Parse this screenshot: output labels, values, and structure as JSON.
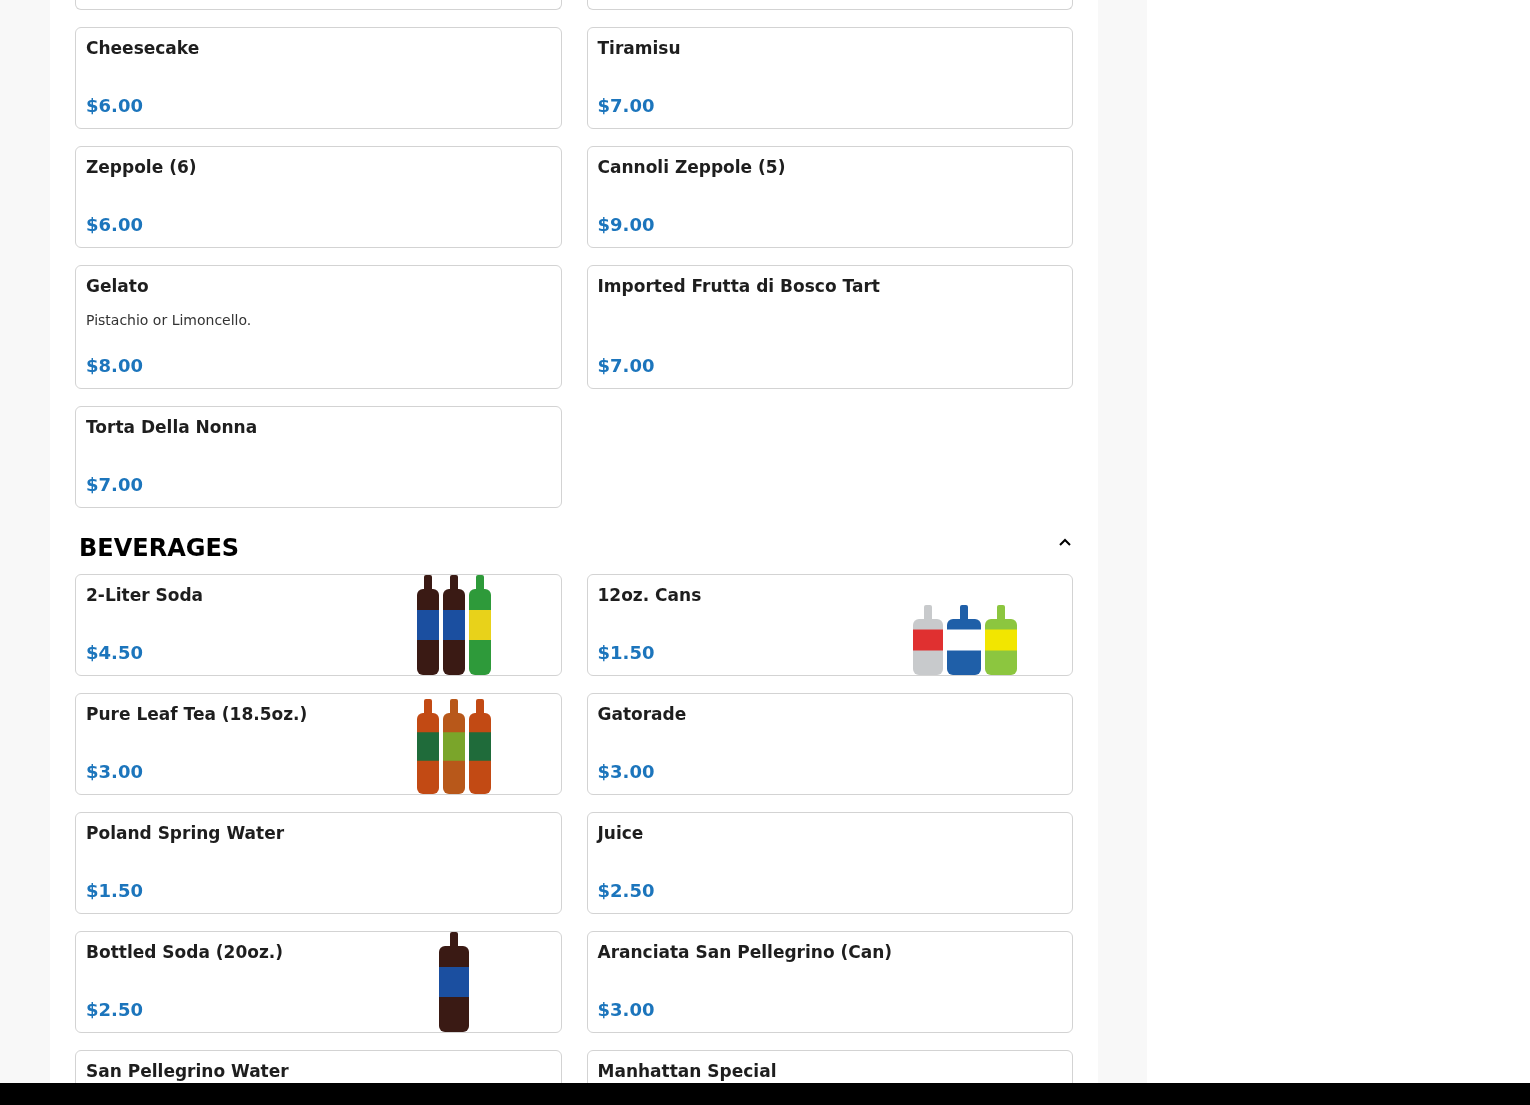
{
  "desserts": {
    "items": [
      {
        "name": "Cheesecake",
        "price": "$6.00"
      },
      {
        "name": "Tiramisu",
        "price": "$7.00"
      },
      {
        "name": "Zeppole (6)",
        "price": "$6.00"
      },
      {
        "name": "Cannoli Zeppole (5)",
        "price": "$9.00"
      },
      {
        "name": "Gelato",
        "description": "Pistachio or Limoncello.",
        "price": "$8.00"
      },
      {
        "name": "Imported Frutta di Bosco Tart",
        "price": "$7.00"
      },
      {
        "name": "Torta Della Nonna",
        "price": "$7.00"
      }
    ]
  },
  "beverages": {
    "title": "BEVERAGES",
    "expanded": true,
    "items": [
      {
        "name": "2-Liter Soda",
        "price": "$4.50",
        "picture": true
      },
      {
        "name": "12oz. Cans",
        "price": "$1.50",
        "picture": true
      },
      {
        "name": "Pure Leaf Tea (18.5oz.)",
        "price": "$3.00",
        "picture": true
      },
      {
        "name": "Gatorade",
        "price": "$3.00",
        "picture": false
      },
      {
        "name": "Poland Spring Water",
        "price": "$1.50",
        "picture": false
      },
      {
        "name": "Juice",
        "price": "$2.50",
        "picture": false
      },
      {
        "name": "Bottled Soda (20oz.)",
        "price": "$2.50",
        "picture": true
      },
      {
        "name": "Aranciata San Pellegrino (Can)",
        "price": "$3.00",
        "picture": false
      },
      {
        "name": "San Pellegrino Water",
        "picture": false
      },
      {
        "name": "Manhattan Special",
        "picture": false
      }
    ]
  }
}
